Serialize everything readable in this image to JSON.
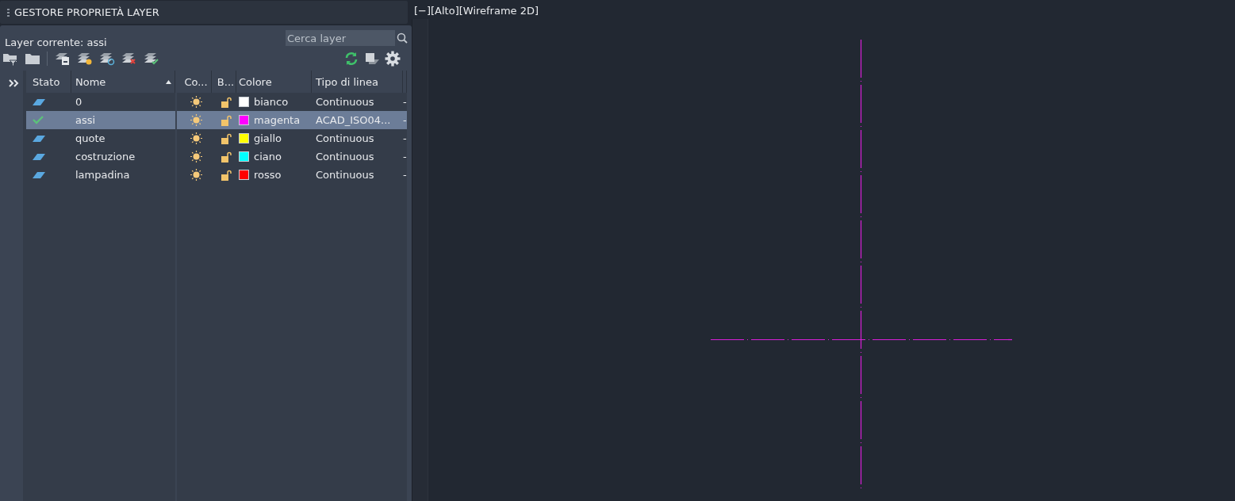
{
  "panel": {
    "title": "GESTORE PROPRIETÀ LAYER",
    "current_layer": "Layer corrente: assi",
    "search": {
      "placeholder": "Cerca layer"
    }
  },
  "table": {
    "columns": [
      "Stato",
      "Nome",
      "Co...",
      "B...",
      "Colore",
      "Tipo di linea"
    ],
    "rows": [
      {
        "current": false,
        "selected": false,
        "name": "0",
        "color": "#ffffff",
        "color_name": "bianco",
        "linetype": "Continuous",
        "column_7": "-"
      },
      {
        "current": true,
        "selected": true,
        "name": "assi",
        "color": "#ff00ff",
        "color_name": "magenta",
        "linetype": "ACAD_ISO04...",
        "column_7": "-"
      },
      {
        "current": false,
        "selected": false,
        "name": "quote",
        "color": "#ffff00",
        "color_name": "giallo",
        "linetype": "Continuous",
        "column_7": "-"
      },
      {
        "current": false,
        "selected": false,
        "name": "costruzione",
        "color": "#00ffff",
        "color_name": "ciano",
        "linetype": "Continuous",
        "column_7": "-"
      },
      {
        "current": false,
        "selected": false,
        "name": "lampadina",
        "color": "#ff0000",
        "color_name": "rosso",
        "linetype": "Continuous",
        "column_7": "-"
      }
    ]
  },
  "viewport": {
    "label": "[−][Alto][Wireframe 2D]"
  }
}
